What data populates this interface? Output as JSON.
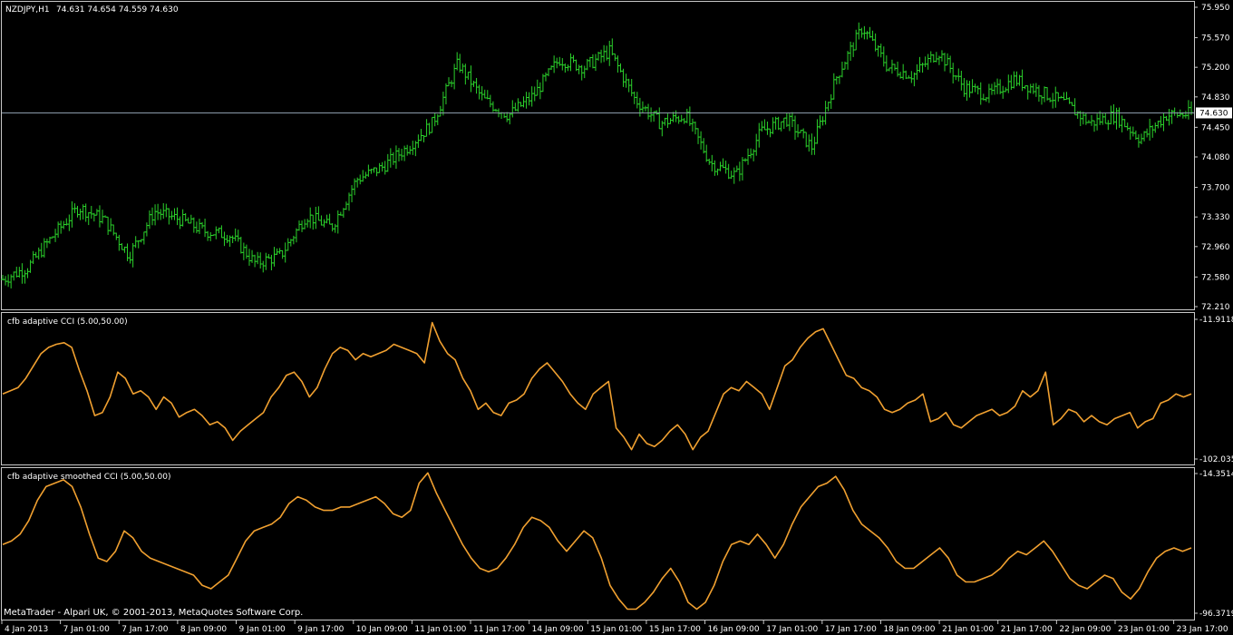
{
  "header": {
    "symbol": "NZDJPY,H1",
    "ohlc": "74.631 74.654 74.559 74.630"
  },
  "footer": {
    "copyright": "MetaTrader - Alpari UK, © 2001-2013, MetaQuotes Software Corp."
  },
  "colors": {
    "background": "#000000",
    "panel_border": "#c8c8c8",
    "bars": "#2bd12b",
    "indicator_line": "#f0a030",
    "bid_line": "#8a9aaa",
    "price_tag_bg": "#ffffff",
    "price_tag_text": "#000000"
  },
  "chart_data": [
    {
      "type": "ohlc",
      "title": "NZDJPY,H1 74.631 74.654 74.559 74.630",
      "y_ticks": [
        "75.950",
        "75.570",
        "75.200",
        "74.830",
        "74.450",
        "74.080",
        "73.700",
        "73.330",
        "72.960",
        "72.580",
        "72.210"
      ],
      "ylim": [
        72.21,
        75.95
      ],
      "current_price": "74.630",
      "close_anchors": [
        72.55,
        72.7,
        73.1,
        73.45,
        73.3,
        72.85,
        73.4,
        73.3,
        73.15,
        73.1,
        72.75,
        72.85,
        73.35,
        73.2,
        73.8,
        73.95,
        74.2,
        74.5,
        75.25,
        74.8,
        74.6,
        74.85,
        75.3,
        75.2,
        75.4,
        74.8,
        74.5,
        74.6,
        74.0,
        73.85,
        74.4,
        74.55,
        74.2,
        75.1,
        75.7,
        75.2,
        75.1,
        75.4,
        74.95,
        74.85,
        75.05,
        74.9,
        74.75,
        74.5,
        74.6,
        74.3,
        74.6,
        74.62
      ]
    },
    {
      "type": "line",
      "title": "cfb adaptive CCI (5.00,50.00)",
      "y_ticks": [
        "-11.9118",
        "-102.035"
      ],
      "ylim": [
        -102.035,
        -11.9118
      ],
      "values": [
        -60,
        -58,
        -56,
        -50,
        -42,
        -34,
        -30,
        -28,
        -27,
        -30,
        -45,
        -58,
        -74,
        -72,
        -62,
        -46,
        -50,
        -60,
        -58,
        -62,
        -70,
        -62,
        -66,
        -75,
        -72,
        -70,
        -74,
        -80,
        -78,
        -82,
        -90,
        -84,
        -80,
        -76,
        -72,
        -62,
        -56,
        -48,
        -46,
        -52,
        -62,
        -56,
        -44,
        -34,
        -30,
        -32,
        -38,
        -34,
        -36,
        -34,
        -32,
        -28,
        -30,
        -32,
        -34,
        -40,
        -14,
        -26,
        -34,
        -38,
        -50,
        -58,
        -70,
        -66,
        -72,
        -74,
        -66,
        -64,
        -60,
        -50,
        -44,
        -40,
        -46,
        -52,
        -60,
        -66,
        -70,
        -60,
        -56,
        -52,
        -82,
        -88,
        -96,
        -86,
        -92,
        -94,
        -90,
        -84,
        -80,
        -86,
        -96,
        -88,
        -84,
        -72,
        -60,
        -56,
        -58,
        -52,
        -56,
        -60,
        -70,
        -56,
        -42,
        -38,
        -30,
        -24,
        -20,
        -18,
        -28,
        -38,
        -48,
        -50,
        -56,
        -58,
        -62,
        -70,
        -72,
        -70,
        -66,
        -64,
        -60,
        -78,
        -76,
        -72,
        -80,
        -82,
        -78,
        -74,
        -72,
        -70,
        -74,
        -72,
        -68,
        -58,
        -62,
        -58,
        -46,
        -80,
        -76,
        -70,
        -72,
        -78,
        -74,
        -78,
        -80,
        -76,
        -74,
        -72,
        -82,
        -78,
        -76,
        -66,
        -64,
        -60,
        -62,
        -60
      ]
    },
    {
      "type": "line",
      "title": "cfb adaptive smoothed CCI (5.00,50.00)",
      "y_ticks": [
        "-14.3514",
        "-96.3719"
      ],
      "ylim": [
        -96.3719,
        -14.3514
      ],
      "values": [
        -56,
        -54,
        -50,
        -42,
        -30,
        -22,
        -20,
        -18,
        -22,
        -34,
        -50,
        -64,
        -66,
        -60,
        -48,
        -52,
        -60,
        -64,
        -66,
        -68,
        -70,
        -72,
        -74,
        -80,
        -82,
        -78,
        -74,
        -64,
        -54,
        -48,
        -46,
        -44,
        -40,
        -32,
        -28,
        -30,
        -34,
        -36,
        -36,
        -34,
        -34,
        -32,
        -30,
        -28,
        -32,
        -38,
        -40,
        -36,
        -20,
        -14,
        -26,
        -36,
        -46,
        -56,
        -64,
        -70,
        -72,
        -70,
        -64,
        -56,
        -46,
        -40,
        -42,
        -46,
        -54,
        -60,
        -54,
        -48,
        -52,
        -64,
        -80,
        -88,
        -94,
        -94,
        -90,
        -84,
        -76,
        -70,
        -78,
        -90,
        -94,
        -90,
        -80,
        -66,
        -56,
        -54,
        -56,
        -50,
        -56,
        -64,
        -56,
        -44,
        -34,
        -28,
        -22,
        -20,
        -16,
        -24,
        -36,
        -44,
        -48,
        -52,
        -58,
        -66,
        -70,
        -70,
        -66,
        -62,
        -58,
        -64,
        -74,
        -78,
        -78,
        -76,
        -74,
        -70,
        -64,
        -60,
        -62,
        -58,
        -54,
        -60,
        -68,
        -76,
        -80,
        -82,
        -78,
        -74,
        -76,
        -84,
        -88,
        -82,
        -72,
        -64,
        -60,
        -58,
        -60,
        -58
      ]
    }
  ],
  "time_axis": [
    "4 Jan 2013",
    "7 Jan 01:00",
    "7 Jan 17:00",
    "8 Jan 09:00",
    "9 Jan 01:00",
    "9 Jan 17:00",
    "10 Jan 09:00",
    "11 Jan 01:00",
    "11 Jan 17:00",
    "14 Jan 09:00",
    "15 Jan 01:00",
    "15 Jan 17:00",
    "16 Jan 09:00",
    "17 Jan 01:00",
    "17 Jan 17:00",
    "18 Jan 09:00",
    "21 Jan 01:00",
    "21 Jan 17:00",
    "22 Jan 09:00",
    "23 Jan 01:00",
    "23 Jan 17:00"
  ]
}
